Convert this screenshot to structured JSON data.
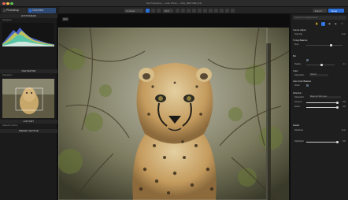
{
  "window": {
    "title": "Nik Photoshop — Auto Photo — IMG_0987.NEF [16]"
  },
  "tabs": [
    {
      "label": "Photoshop",
      "color": "#4a4a4a"
    },
    {
      "label": "Overview",
      "color": "#2a6fdb"
    }
  ],
  "toolbar": {
    "zoom_label": "Contrast",
    "zoom_value": "22.6",
    "right_buttons": [
      "Export",
      "Done"
    ]
  },
  "left_panel": {
    "histogram_title": "HISTOGRAM",
    "histogram_sub": "Histogram",
    "navigator_title": "NAVIGATOR",
    "navigator_sub": "Navigation",
    "history_title": "HISTORY",
    "history_item": "Rasterize History",
    "preset_title": "PRESET EDITOR"
  },
  "canvas": {
    "zoom_chip": "Edit"
  },
  "right_panel": {
    "search_placeholder": "Search for Adjustments",
    "sections": [
      {
        "label": "Curves Adjust",
        "value": ""
      },
      {
        "label": "Toning Balance",
        "value": ""
      },
      {
        "label": "Mix",
        "value": ""
      },
      {
        "label": "Color",
        "value": ""
      },
      {
        "label": "Auto Color Balance",
        "value": ""
      },
      {
        "label": "Selective",
        "value": ""
      },
      {
        "label": "Details",
        "value": ""
      }
    ],
    "rows": [
      {
        "label": "Intensity",
        "value": "Auto"
      },
      {
        "label": "Fine",
        "value": ""
      },
      {
        "label": "Radius",
        "value": "4.4"
      },
      {
        "label": "Saturation",
        "value": "Natural"
      },
      {
        "label": "Grain",
        "value": ""
      },
      {
        "label": "Saturation",
        "value": "Based on Skin tones"
      },
      {
        "label": "Amount",
        "value": "100"
      },
      {
        "label": "Gloss",
        "value": "100"
      },
      {
        "label": "Shadows",
        "value": "Auto"
      },
      {
        "label": "Highlights",
        "value": "100"
      }
    ]
  },
  "colors": {
    "accent": "#2a6fdb",
    "panel": "#1e1e1e",
    "bg": "#111111"
  }
}
